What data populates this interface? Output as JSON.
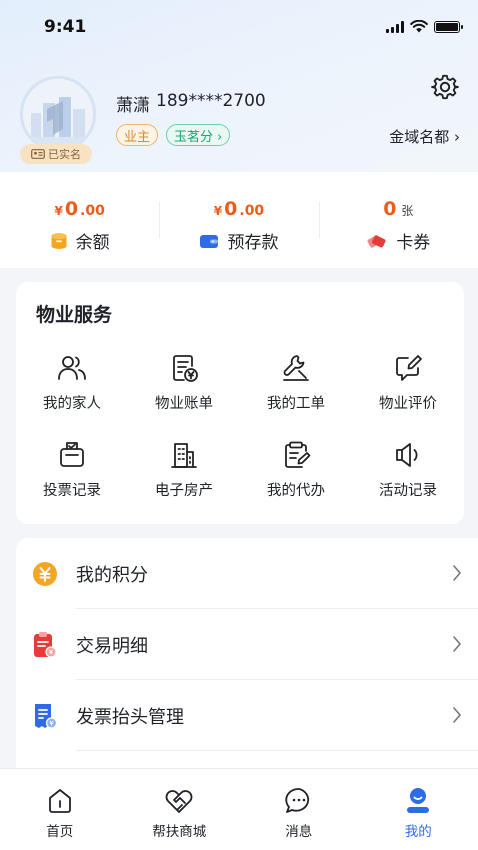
{
  "status_bar": {
    "time": "9:41"
  },
  "profile": {
    "name": "萧潇",
    "phone": "189****2700",
    "verified_label": "已实名",
    "tags": {
      "owner": "业主",
      "score": "玉茗分 ›"
    },
    "community": "金域名都 ›"
  },
  "balances": [
    {
      "prefix": "¥",
      "value": "0",
      "suffix": ".00",
      "unit": "",
      "label": "余额",
      "icon": "wallet-coin-icon",
      "color": "#f5a524"
    },
    {
      "prefix": "¥",
      "value": "0",
      "suffix": ".00",
      "unit": "",
      "label": "预存款",
      "icon": "wallet-icon",
      "color": "#2f6be6"
    },
    {
      "prefix": "",
      "value": "0",
      "suffix": "",
      "unit": "张",
      "label": "卡券",
      "icon": "coupon-icon",
      "color": "#e53b3b"
    }
  ],
  "property_services": {
    "title": "物业服务",
    "items": [
      {
        "label": "我的家人",
        "icon": "family-icon"
      },
      {
        "label": "物业账单",
        "icon": "bill-icon"
      },
      {
        "label": "我的工单",
        "icon": "work-order-icon"
      },
      {
        "label": "物业评价",
        "icon": "review-icon"
      },
      {
        "label": "投票记录",
        "icon": "vote-icon"
      },
      {
        "label": "电子房产",
        "icon": "building-icon"
      },
      {
        "label": "我的代办",
        "icon": "todo-icon"
      },
      {
        "label": "活动记录",
        "icon": "speaker-icon"
      }
    ]
  },
  "menu_list": [
    {
      "label": "我的积分",
      "icon": "points-icon"
    },
    {
      "label": "交易明细",
      "icon": "transactions-icon"
    },
    {
      "label": "发票抬头管理",
      "icon": "invoice-icon"
    }
  ],
  "tab_bar": {
    "tabs": [
      {
        "label": "首页",
        "icon": "home-icon",
        "active": false
      },
      {
        "label": "帮扶商城",
        "icon": "handshake-icon",
        "active": false
      },
      {
        "label": "消息",
        "icon": "message-icon",
        "active": false
      },
      {
        "label": "我的",
        "icon": "profile-icon",
        "active": true
      }
    ]
  },
  "colors": {
    "accent": "#2f6be6",
    "price": "#ee5b1b",
    "owner_tag": "#e08a28",
    "score_tag": "#1aa37a"
  }
}
